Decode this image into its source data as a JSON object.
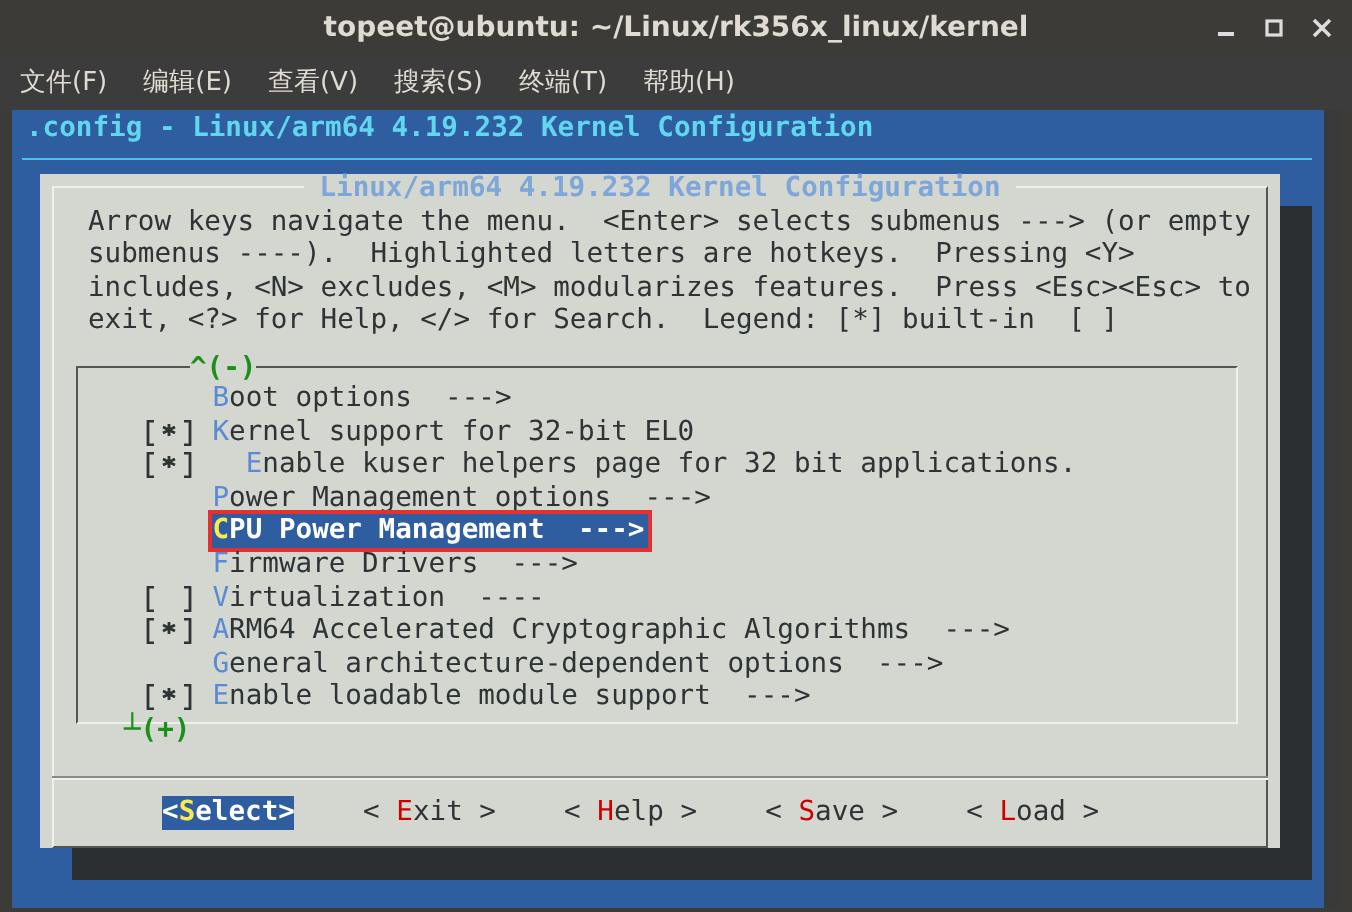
{
  "window": {
    "title": "topeet@ubuntu: ~/Linux/rk356x_linux/kernel"
  },
  "menubar": [
    "文件(F)",
    "编辑(E)",
    "查看(V)",
    "搜索(S)",
    "终端(T)",
    "帮助(H)"
  ],
  "terminal": {
    "header": ".config - Linux/arm64 4.19.232 Kernel Configuration",
    "dialog": {
      "title": "Linux/arm64 4.19.232 Kernel Configuration",
      "help": "Arrow keys navigate the menu.  <Enter> selects submenus ---> (or empty\nsubmenus ----).  Highlighted letters are hotkeys.  Pressing <Y>\nincludes, <N> excludes, <M> modularizes features.  Press <Esc><Esc> to\nexit, <?> for Help, </> for Search.  Legend: [*] built-in  [ ]",
      "scroll_up": "^(-)",
      "scroll_down": "┴(+)",
      "items": [
        {
          "kind": "menu",
          "label": "Boot options",
          "arrow": "--->",
          "selected": false,
          "marked": false
        },
        {
          "kind": "bool",
          "checked": true,
          "label": "Kernel support for 32-bit EL0",
          "selected": false,
          "marked": false,
          "children": [
            {
              "kind": "bool",
              "checked": true,
              "label": "Enable kuser helpers page for 32 bit applications.",
              "selected": false,
              "marked": false
            }
          ]
        },
        {
          "kind": "menu",
          "label": "Power Management options",
          "arrow": "--->",
          "selected": false,
          "marked": false
        },
        {
          "kind": "menu",
          "label": "CPU Power Management",
          "arrow": "--->",
          "selected": true,
          "marked": true
        },
        {
          "kind": "menu",
          "label": "Firmware Drivers",
          "arrow": "--->",
          "selected": false,
          "marked": false
        },
        {
          "kind": "bool",
          "checked": false,
          "label": "Virtualization",
          "arrow": "----",
          "selected": false,
          "marked": false
        },
        {
          "kind": "bool",
          "checked": true,
          "label": "ARM64 Accelerated Cryptographic Algorithms",
          "arrow": "--->",
          "selected": false,
          "marked": false
        },
        {
          "kind": "menu",
          "label": "General architecture-dependent options",
          "arrow": "--->",
          "selected": false,
          "marked": false
        },
        {
          "kind": "bool",
          "checked": true,
          "label": "Enable loadable module support",
          "arrow": "--->",
          "selected": false,
          "marked": false
        }
      ],
      "buttons": [
        {
          "left": "<",
          "key": "S",
          "rest": "elect",
          "right": ">",
          "selected": true
        },
        {
          "left": "< ",
          "key": "E",
          "rest": "xit",
          "right": " >",
          "selected": false
        },
        {
          "left": "< ",
          "key": "H",
          "rest": "elp",
          "right": " >",
          "selected": false
        },
        {
          "left": "< ",
          "key": "S",
          "rest": "ave",
          "right": " >",
          "selected": false
        },
        {
          "left": "< ",
          "key": "L",
          "rest": "oad",
          "right": " >",
          "selected": false
        }
      ]
    }
  }
}
